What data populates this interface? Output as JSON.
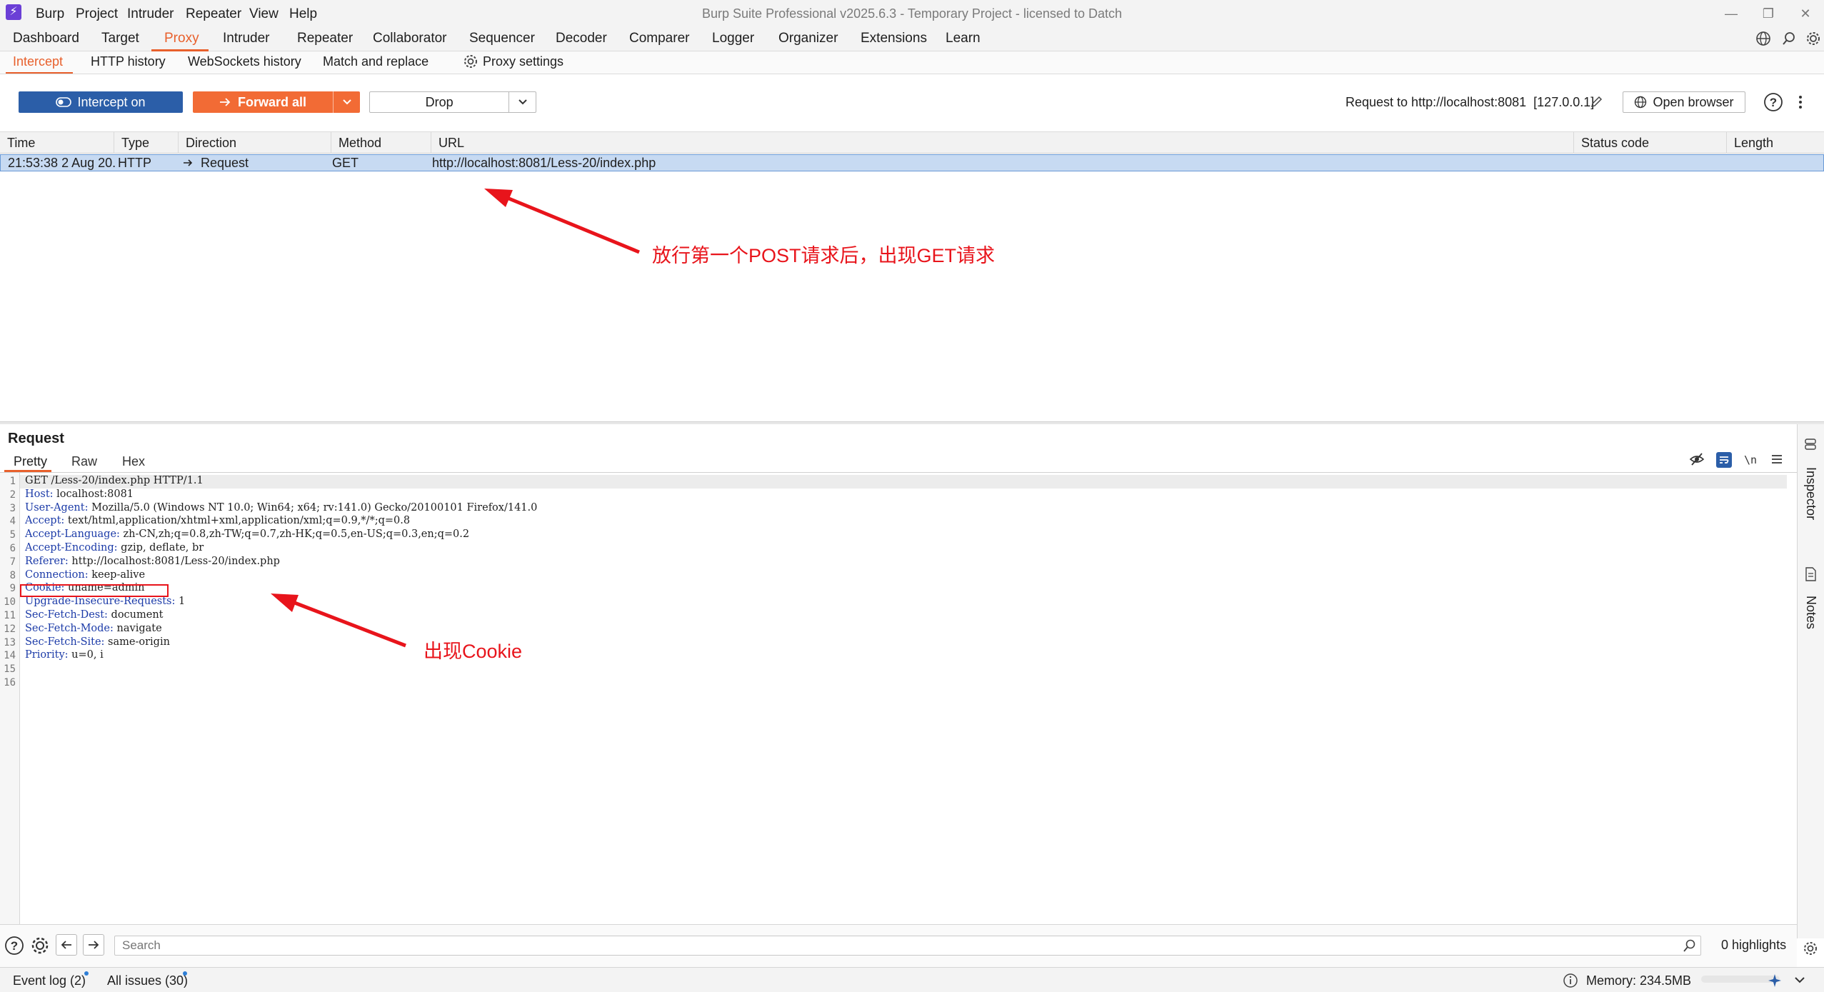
{
  "window": {
    "title": "Burp Suite Professional v2025.6.3 - Temporary Project - licensed to Datch",
    "menu": [
      "Burp",
      "Project",
      "Intruder",
      "Repeater",
      "View",
      "Help"
    ]
  },
  "main_tabs": [
    "Dashboard",
    "Target",
    "Proxy",
    "Intruder",
    "Repeater",
    "Collaborator",
    "Sequencer",
    "Decoder",
    "Comparer",
    "Logger",
    "Organizer",
    "Extensions",
    "Learn"
  ],
  "active_main_tab": "Proxy",
  "sub_tabs": [
    "Intercept",
    "HTTP history",
    "WebSockets history",
    "Match and replace",
    "Proxy settings"
  ],
  "active_sub_tab": "Intercept",
  "toolbar": {
    "intercept_label": "Intercept on",
    "forward_label": "Forward all",
    "drop_label": "Drop",
    "request_to": "Request to http://localhost:8081  [127.0.0.1]",
    "open_browser_label": "Open browser"
  },
  "table": {
    "columns": [
      "Time",
      "Type",
      "Direction",
      "Method",
      "URL",
      "Status code",
      "Length"
    ],
    "rows": [
      {
        "time": "21:53:38 2 Aug 20...",
        "type": "HTTP",
        "direction": "Request",
        "method": "GET",
        "url": "http://localhost:8081/Less-20/index.php",
        "status": "",
        "length": ""
      }
    ]
  },
  "annotations": {
    "top": "放行第一个POST请求后，出现GET请求",
    "bottom": "出现Cookie"
  },
  "request_pane": {
    "title": "Request",
    "tabs": [
      "Pretty",
      "Raw",
      "Hex"
    ],
    "active_tab": "Pretty",
    "lines": [
      {
        "n": "1",
        "key": "",
        "val": "GET /Less-20/index.php HTTP/1.1"
      },
      {
        "n": "2",
        "key": "Host:",
        "val": " localhost:8081"
      },
      {
        "n": "3",
        "key": "User-Agent:",
        "val": " Mozilla/5.0 (Windows NT 10.0; Win64; x64; rv:141.0) Gecko/20100101 Firefox/141.0"
      },
      {
        "n": "4",
        "key": "Accept:",
        "val": " text/html,application/xhtml+xml,application/xml;q=0.9,*/*;q=0.8"
      },
      {
        "n": "5",
        "key": "Accept-Language:",
        "val": " zh-CN,zh;q=0.8,zh-TW;q=0.7,zh-HK;q=0.5,en-US;q=0.3,en;q=0.2"
      },
      {
        "n": "6",
        "key": "Accept-Encoding:",
        "val": " gzip, deflate, br"
      },
      {
        "n": "7",
        "key": "Referer:",
        "val": " http://localhost:8081/Less-20/index.php"
      },
      {
        "n": "8",
        "key": "Connection:",
        "val": " keep-alive"
      },
      {
        "n": "9",
        "key": "Cookie:",
        "val": " uname=admin"
      },
      {
        "n": "10",
        "key": "Upgrade-Insecure-Requests:",
        "val": " 1"
      },
      {
        "n": "11",
        "key": "Sec-Fetch-Dest:",
        "val": " document"
      },
      {
        "n": "12",
        "key": "Sec-Fetch-Mode:",
        "val": " navigate"
      },
      {
        "n": "13",
        "key": "Sec-Fetch-Site:",
        "val": " same-origin"
      },
      {
        "n": "14",
        "key": "Priority:",
        "val": " u=0, i"
      },
      {
        "n": "15",
        "key": "",
        "val": ""
      },
      {
        "n": "16",
        "key": "",
        "val": ""
      }
    ]
  },
  "sidebar": {
    "inspector": "Inspector",
    "notes": "Notes"
  },
  "search": {
    "placeholder": "Search",
    "highlights": "0 highlights"
  },
  "status": {
    "event_log": "Event log (2)",
    "all_issues": "All issues (30)",
    "memory": "Memory: 234.5MB"
  },
  "colors": {
    "accent": "#e8602c",
    "intercept": "#2b5ea8",
    "forward": "#f26b35",
    "annotation": "#e8141b",
    "selected_row": "#c7daf2",
    "header_key": "#1c3ba8"
  }
}
